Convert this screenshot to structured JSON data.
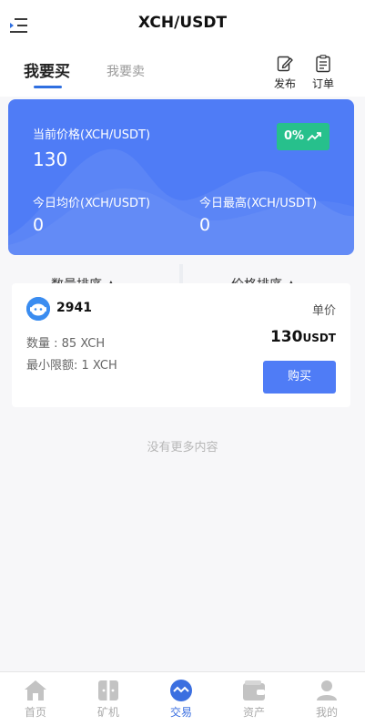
{
  "header": {
    "title": "XCH/USDT",
    "menu_icon": "menu-icon"
  },
  "tabs": {
    "buy_label": "我要买",
    "sell_label": "我要卖"
  },
  "toolbar": {
    "publish_label": "发布",
    "publish_icon": "edit-icon",
    "orders_label": "订单",
    "orders_icon": "clipboard-icon"
  },
  "price_card": {
    "current_price_label": "当前价格(XCH/USDT)",
    "current_price_value": "130",
    "change_label": "0%",
    "change_icon": "trending-up-icon",
    "avg_label": "今日均价(XCH/USDT)",
    "avg_value": "0",
    "high_label": "今日最高(XCH/USDT)",
    "high_value": "0",
    "accent_color": "#4f7cf6",
    "badge_color": "#27c08c"
  },
  "sort": {
    "quantity_label": "数量排序 ▲",
    "price_label": "价格排序 ▲"
  },
  "orders": [
    {
      "merchant": "2941",
      "unit_price_label": "单价",
      "quantity_text": "数量 : 85 XCH",
      "min_limit_text": "最小限额: 1 XCH",
      "price_value": "130",
      "price_currency": "USDT",
      "buy_label": "购买"
    }
  ],
  "footer_text": "没有更多内容",
  "bottom_nav": {
    "items": [
      {
        "label": "首页",
        "icon": "home-icon",
        "active": false
      },
      {
        "label": "矿机",
        "icon": "miner-icon",
        "active": false
      },
      {
        "label": "交易",
        "icon": "trade-icon",
        "active": true
      },
      {
        "label": "资产",
        "icon": "wallet-icon",
        "active": false
      },
      {
        "label": "我的",
        "icon": "user-icon",
        "active": false
      }
    ]
  }
}
